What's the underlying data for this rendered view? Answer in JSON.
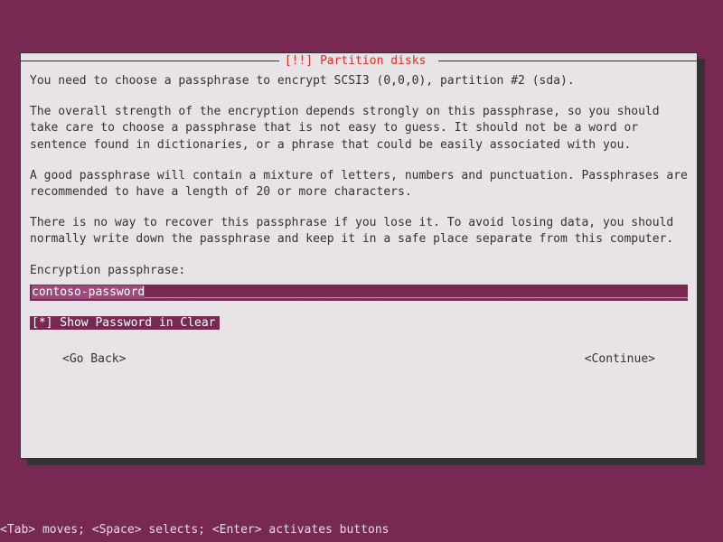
{
  "dialog": {
    "title_prefix": "[!!] ",
    "title": "Partition disks",
    "paragraphs": {
      "p1": "You need to choose a passphrase to encrypt SCSI3 (0,0,0), partition #2 (sda).",
      "p2": "The overall strength of the encryption depends strongly on this passphrase, so you should take care to choose a passphrase that is not easy to guess. It should not be a word or sentence found in dictionaries, or a phrase that could be easily associated with you.",
      "p3": "A good passphrase will contain a mixture of letters, numbers and punctuation. Passphrases are recommended to have a length of 20 or more characters.",
      "p4": "There is no way to recover this passphrase if you lose it. To avoid losing data, you should normally write down the passphrase and keep it in a safe place separate from this computer."
    },
    "field_label": "Encryption passphrase:",
    "passphrase_value": "contoso-password",
    "passphrase_fill": "________________________________________________________________________________",
    "checkbox": {
      "mark": "[*]",
      "label": " Show Password in Clear"
    },
    "buttons": {
      "back": "<Go Back>",
      "continue": "<Continue>"
    }
  },
  "help": "<Tab> moves; <Space> selects; <Enter> activates buttons"
}
